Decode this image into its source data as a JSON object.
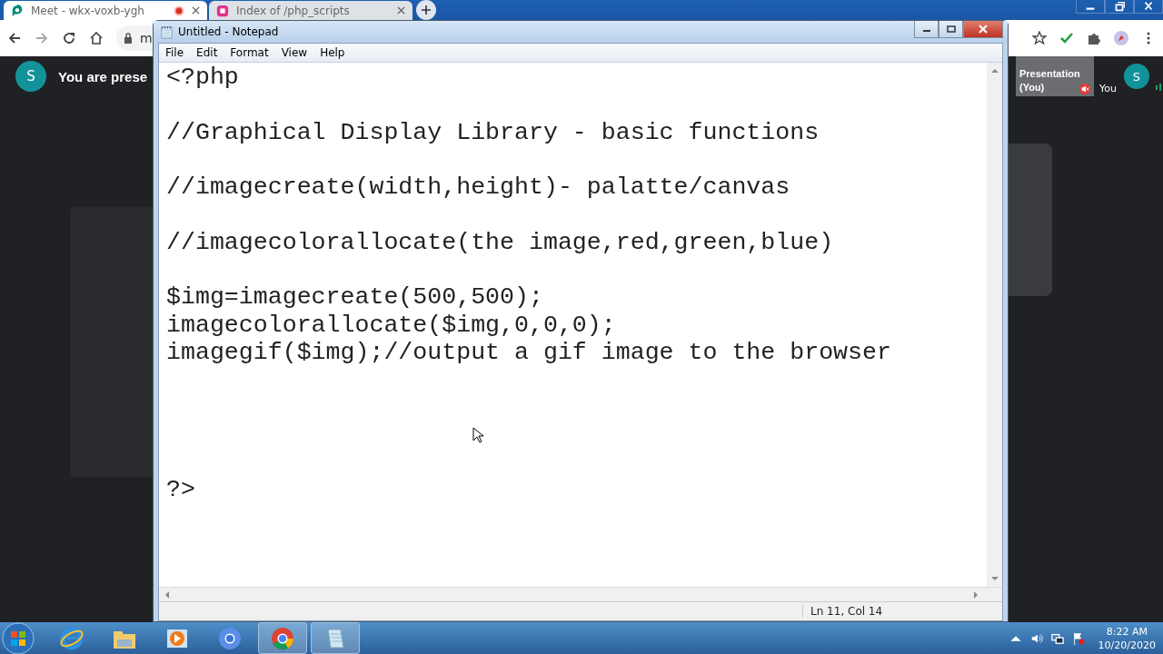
{
  "browser": {
    "tabs": [
      {
        "title": "Meet - wkx-voxb-ygh",
        "selected": true,
        "recording": true
      },
      {
        "title": "Index of /php_scripts",
        "selected": false,
        "recording": false
      }
    ],
    "address": "m",
    "meet": {
      "avatar": "S",
      "banner": "You are prese",
      "tiles": [
        {
          "kind": "presentation",
          "label": "Presentation (You)",
          "muted": true
        },
        {
          "kind": "self",
          "label": "You",
          "avatar": "S",
          "muted": false
        }
      ]
    }
  },
  "notepad": {
    "title": "Untitled - Notepad",
    "menu": [
      "File",
      "Edit",
      "Format",
      "View",
      "Help"
    ],
    "text": "<?php\n\n//Graphical Display Library - basic functions\n\n//imagecreate(width,height)- palatte/canvas\n\n//imagecolorallocate(the image,red,green,blue)\n\n$img=imagecreate(500,500);\nimagecolorallocate($img,0,0,0);\nimagegif($img);//output a gif image to the browser\n\n\n\n\n?>",
    "status": "Ln 11, Col 14"
  },
  "taskbar": {
    "apps": [
      {
        "kind": "ie",
        "selected": false
      },
      {
        "kind": "folder",
        "selected": false
      },
      {
        "kind": "media",
        "selected": false
      },
      {
        "kind": "chromium",
        "selected": false
      },
      {
        "kind": "chrome",
        "selected": true
      },
      {
        "kind": "notepad",
        "selected": true
      }
    ],
    "time": "8:22 AM",
    "date": "10/20/2020"
  }
}
